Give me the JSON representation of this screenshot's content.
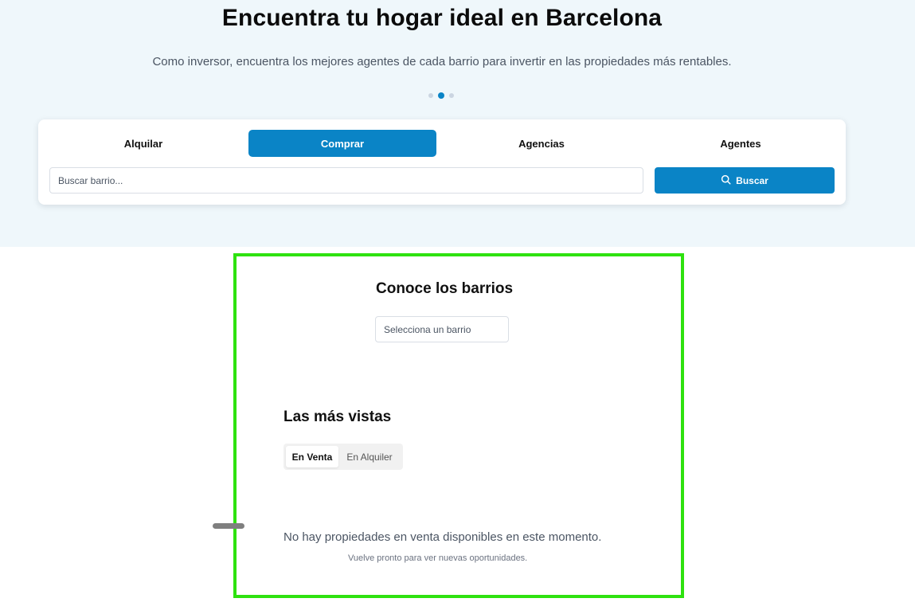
{
  "hero": {
    "title": "Encuentra tu hogar ideal en Barcelona",
    "subtitle": "Como inversor, encuentra los mejores agentes de cada barrio para invertir en las propiedades más rentables.",
    "carousel": {
      "count": 3,
      "active_index": 1
    }
  },
  "search": {
    "tabs": [
      {
        "label": "Alquilar",
        "active": false
      },
      {
        "label": "Comprar",
        "active": true
      },
      {
        "label": "Agencias",
        "active": false
      },
      {
        "label": "Agentes",
        "active": false
      }
    ],
    "input_placeholder": "Buscar barrio...",
    "input_value": "",
    "button_label": "Buscar",
    "button_icon": "search-icon"
  },
  "barrios": {
    "title": "Conoce los barrios",
    "select_placeholder": "Selecciona un barrio"
  },
  "most_viewed": {
    "title": "Las más vistas",
    "toggle": [
      {
        "label": "En Venta",
        "active": true
      },
      {
        "label": "En Alquiler",
        "active": false
      }
    ],
    "empty_message": "No hay propiedades en venta disponibles en este momento.",
    "empty_sub": "Vuelve pronto para ver nuevas oportunidades."
  },
  "colors": {
    "accent": "#0a84c6",
    "hero_bg": "#eff7fb",
    "highlight_frame": "#2ee20f"
  }
}
